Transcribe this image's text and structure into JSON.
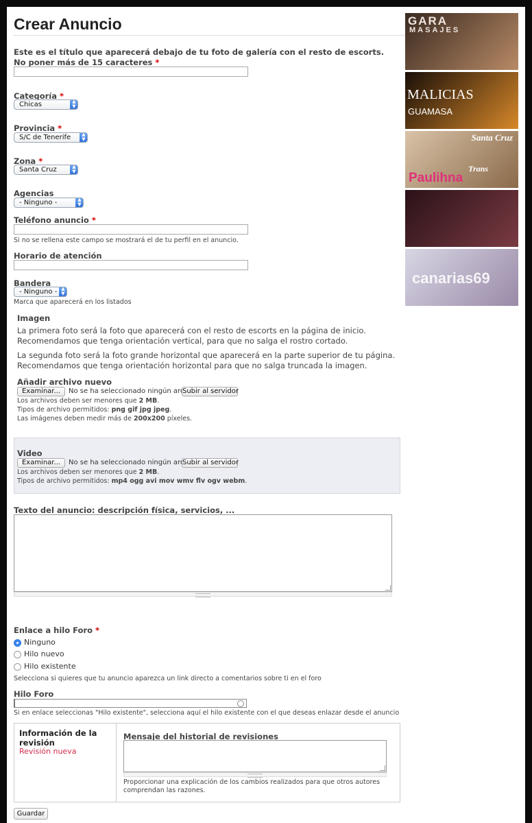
{
  "page_title": "Crear Anuncio",
  "fields": {
    "titulo": {
      "label": "Este es el título que aparecerá debajo de tu foto de galería con el resto de escorts. No poner más de 15 caracteres",
      "required": "*",
      "value": ""
    },
    "categoria": {
      "label": "Categoría",
      "required": "*",
      "value": "Chicas"
    },
    "provincia": {
      "label": "Provincia",
      "required": "*",
      "value": "S/C de Tenerife"
    },
    "zona": {
      "label": "Zona",
      "required": "*",
      "value": "Santa Cruz"
    },
    "agencias": {
      "label": "Agencias",
      "value": "- Ninguno -"
    },
    "telefono": {
      "label": "Teléfono anuncio",
      "required": "*",
      "value": "",
      "description": "Si no se rellena este campo se mostrará el de tu perfil en el anuncio."
    },
    "horario": {
      "label": "Horario de atención",
      "value": ""
    },
    "bandera": {
      "label": "Bandera",
      "value": "- Ninguno -",
      "description": "Marca que aparecerá en los listados"
    }
  },
  "imagen": {
    "heading": "Imagen",
    "paragraph1": "La primera foto será la foto que aparecerá con el resto de escorts en la página de inicio. Recomendamos que tenga orientación vertical, para que no salga el rostro cortado.",
    "paragraph2": "La segunda foto será la foto grande horizontal que aparecerá en la parte superior de tu página. Recomendamos que tenga orientación horizontal para que no salga truncada la imagen.",
    "add_label": "Añadir archivo nuevo",
    "browse_label": "Examinar...",
    "no_file": "No se ha seleccionado ningún archivo.",
    "upload_label": "Subir al servidor",
    "size_prefix": "Los archivos deben ser menores que ",
    "size": "2 MB",
    "types_prefix": "Tipos de archivo permitidos: ",
    "types": "png gif jpg jpeg",
    "dims_prefix": "Las imágenes deben medir más de ",
    "dims": "200x200",
    "dims_suffix": " píxeles."
  },
  "video": {
    "heading": "Video",
    "browse_label": "Examinar...",
    "no_file": "No se ha seleccionado ningún archivo.",
    "upload_label": "Subir al servidor",
    "size_prefix": "Los archivos deben ser menores que ",
    "size": "2 MB",
    "types_prefix": "Tipos de archivo permitidos: ",
    "types": "mp4 ogg avi mov wmv flv ogv webm"
  },
  "texto": {
    "label": "Texto del anuncio: descripción física, servicios, ...",
    "value": ""
  },
  "enlace": {
    "label": "Enlace a hilo Foro",
    "required": "*",
    "options": [
      "Ninguno",
      "Hilo nuevo",
      "Hilo existente"
    ],
    "selected": "Ninguno",
    "description": "Selecciona si quieres que tu anuncio aparezca un link directo a comentarios sobre ti en el foro"
  },
  "hilo": {
    "label": "Hilo Foro",
    "value": "",
    "description": "Si en enlace seleccionas \"Hilo existente\", selecciona aquí el hilo existente con el que deseas enlazar desde el anuncio"
  },
  "revision": {
    "tab_title": "Información de la revisión",
    "tab_link": "Revisión nueva",
    "message_label": "Mensaje del historial de revisiones",
    "message_value": "",
    "message_description": "Proporcionar una explicación de los cambios realizados para que otros autores comprendan las razones."
  },
  "submit_label": "Guardar",
  "ads": [
    {
      "line1": "GARA",
      "line2": "MASAJES",
      "colors": [
        "#3a2a20",
        "#b88a66"
      ]
    },
    {
      "line1": "MALICIAS",
      "line2": "GUAMASA",
      "colors": [
        "#1a0f08",
        "#d6882a"
      ]
    },
    {
      "line1": "Santa Cruz",
      "line2": "Trans",
      "line3": "Paulihna",
      "colors": [
        "#d9c3a8",
        "#8a6a4a"
      ]
    },
    {
      "line1": "",
      "colors": [
        "#2a1218",
        "#7a3a42"
      ]
    },
    {
      "line1": "canarias69",
      "colors": [
        "#d8d6e4",
        "#9a8aa8"
      ]
    }
  ],
  "colors": {
    "required": "#d40000",
    "revision_link": "#d12b4b",
    "accent": "#3b87ef"
  }
}
